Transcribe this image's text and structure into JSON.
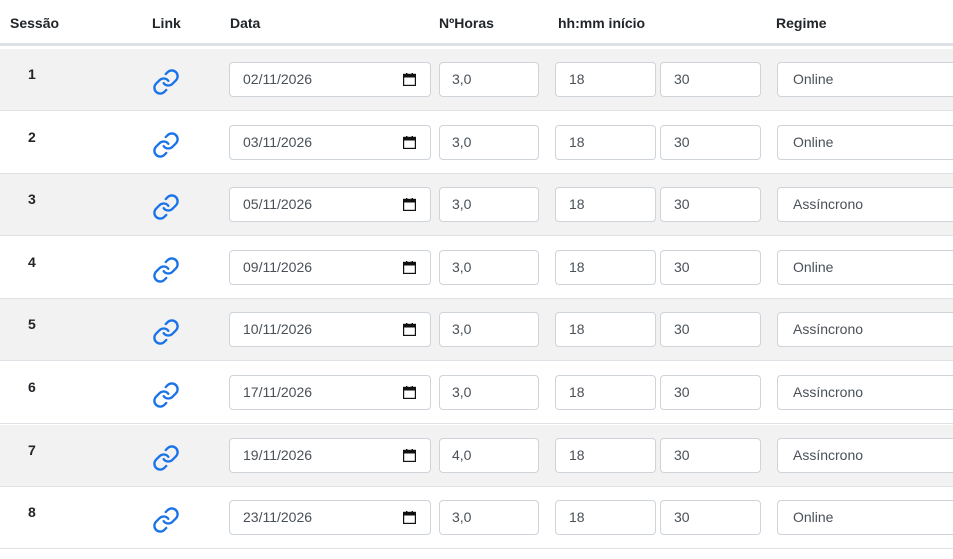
{
  "header": {
    "session": "Sessão",
    "link": "Link",
    "date": "Data",
    "hours": "NºHoras",
    "start": "hh:mm início",
    "regime": "Regime"
  },
  "icons": {
    "link": "link-icon",
    "calendar": "calendar-icon"
  },
  "colors": {
    "link_icon": "#1a73e8",
    "stripe": "#f2f2f2"
  },
  "rows": [
    {
      "session": "1",
      "date": "02/11/2026",
      "hours": "3,0",
      "hh": "18",
      "mm": "30",
      "regime": "Online"
    },
    {
      "session": "2",
      "date": "03/11/2026",
      "hours": "3,0",
      "hh": "18",
      "mm": "30",
      "regime": "Online"
    },
    {
      "session": "3",
      "date": "05/11/2026",
      "hours": "3,0",
      "hh": "18",
      "mm": "30",
      "regime": "Assíncrono"
    },
    {
      "session": "4",
      "date": "09/11/2026",
      "hours": "3,0",
      "hh": "18",
      "mm": "30",
      "regime": "Online"
    },
    {
      "session": "5",
      "date": "10/11/2026",
      "hours": "3,0",
      "hh": "18",
      "mm": "30",
      "regime": "Assíncrono"
    },
    {
      "session": "6",
      "date": "17/11/2026",
      "hours": "3,0",
      "hh": "18",
      "mm": "30",
      "regime": "Assíncrono"
    },
    {
      "session": "7",
      "date": "19/11/2026",
      "hours": "4,0",
      "hh": "18",
      "mm": "30",
      "regime": "Assíncrono"
    },
    {
      "session": "8",
      "date": "23/11/2026",
      "hours": "3,0",
      "hh": "18",
      "mm": "30",
      "regime": "Online"
    }
  ]
}
